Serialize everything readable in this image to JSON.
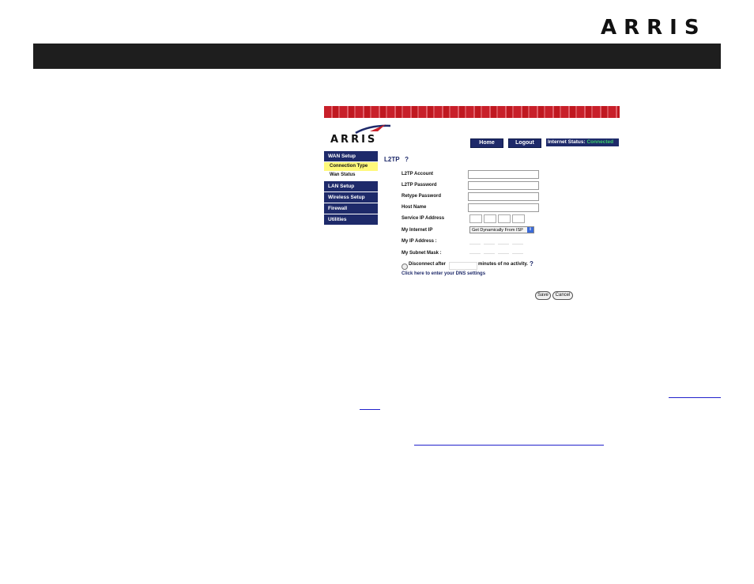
{
  "brand": {
    "logo_text": "ARRIS"
  },
  "screenshot": {
    "logo_text": "ARRIS",
    "nav": {
      "home": "Home",
      "logout": "Logout"
    },
    "internet_status": {
      "label": "Internet Status:",
      "value": "Connected"
    },
    "sidebar": [
      {
        "label": "WAN Setup",
        "children": [
          {
            "label": "Connection Type",
            "active": true
          },
          {
            "label": "Wan Status",
            "active": false
          }
        ]
      },
      {
        "label": "LAN Setup"
      },
      {
        "label": "Wireless Setup"
      },
      {
        "label": "Firewall"
      },
      {
        "label": "Utilities"
      }
    ],
    "form": {
      "title": "L2TP",
      "help_glyph": "?",
      "fields": {
        "l2tp_account": "L2TP Account",
        "l2tp_password": "L2TP Password",
        "retype_password": "Retype Password",
        "host_name": "Host Name",
        "service_ip": "Service IP Address",
        "my_internet_ip": "My Internet IP",
        "my_ip_address": "My IP Address :",
        "my_subnet_mask": "My Subnet Mask :"
      },
      "internet_ip_selected": "Get Dynamically From ISP",
      "disconnect_label": "Disconnect after",
      "minutes_label": "minutes of no activity.",
      "dns_link": "Click here to enter your DNS settings",
      "save": "Save",
      "cancel": "Cancel"
    }
  },
  "colors": {
    "header_bar": "#1e1e1e",
    "nav_blue": "#1e2a6a",
    "status_green": "#3ccf6a",
    "active_yellow": "#fff97a",
    "strip_red": "#c8202a"
  }
}
